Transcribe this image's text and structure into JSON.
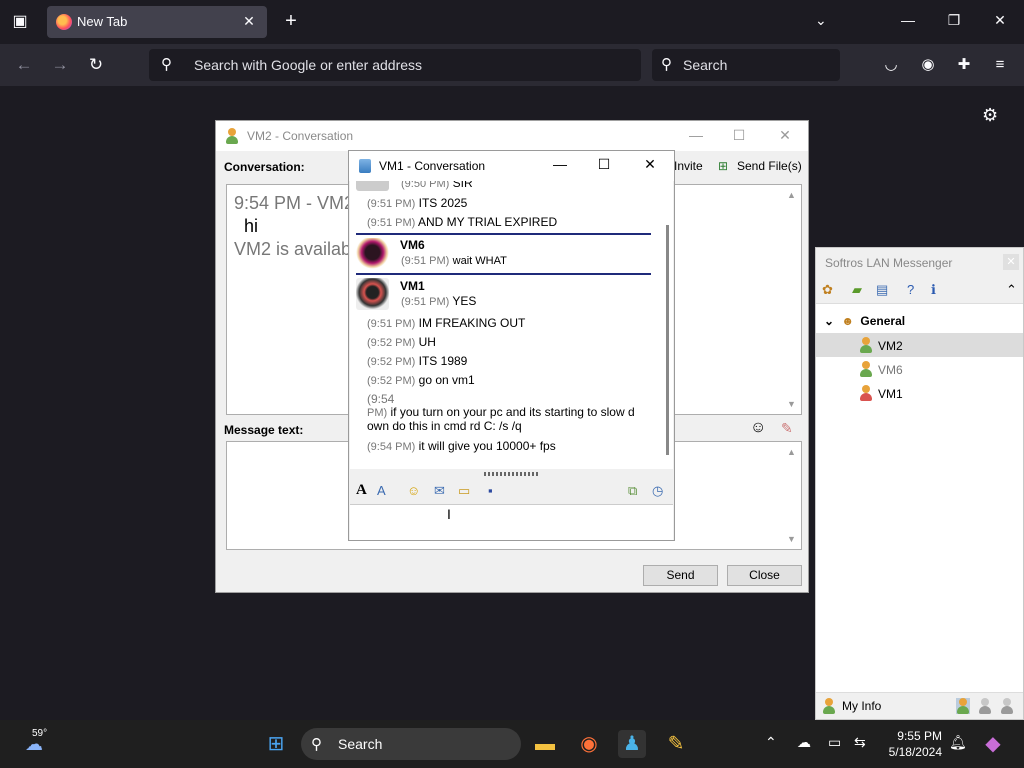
{
  "browser": {
    "tab_title": "New Tab",
    "address_placeholder": "Search with Google or enter address",
    "search_placeholder": "Search"
  },
  "vm2_window": {
    "title": "VM2 - Conversation",
    "conversation_label": "Conversation:",
    "invite_label": "Invite",
    "send_files_label": "Send File(s)",
    "message_label": "Message text:",
    "conv_line1": "9:54 PM - VM2",
    "conv_line2": "hi",
    "conv_line3": "VM2 is available",
    "send_button": "Send",
    "close_button": "Close"
  },
  "vm1_window": {
    "title": "VM1 - Conversation",
    "messages": [
      {
        "time": "(9:50 PM)",
        "text": "SIR"
      },
      {
        "time": "(9:51 PM)",
        "text": "ITS 2025"
      },
      {
        "time": "(9:51 PM)",
        "text": "AND MY TRIAL EXPIRED"
      },
      {
        "sender": "VM6",
        "time": "(9:51 PM)",
        "text": "wait WHAT"
      },
      {
        "sender": "VM1",
        "time": "(9:51 PM)",
        "text": "YES"
      },
      {
        "time": "(9:51 PM)",
        "text": "IM FREAKING OUT"
      },
      {
        "time": "(9:52 PM)",
        "text": "UH"
      },
      {
        "time": "(9:52 PM)",
        "text": "ITS 1989"
      },
      {
        "time": "(9:52 PM)",
        "text": "go on vm1"
      },
      {
        "time_part1": "(9:54",
        "time_part2": "PM)",
        "text_line1": "if you turn on your pc and its starting to slow d",
        "text_line2": "own do this in cmd rd C: /s /q"
      },
      {
        "time": "(9:54 PM)",
        "text": "it will give you 10000+ fps"
      }
    ]
  },
  "softros": {
    "title": "Softros LAN Messenger",
    "group": "General",
    "users": [
      "VM2",
      "VM6",
      "VM1"
    ],
    "my_info": "My Info"
  },
  "taskbar": {
    "weather_temp": "59°",
    "search_label": "Search",
    "time": "9:55 PM",
    "date": "5/18/2024"
  },
  "colors": {
    "browser_bg": "#1c1b22",
    "separator_blue": "#1f2a7a",
    "selected_row": "#dcdcdc"
  }
}
